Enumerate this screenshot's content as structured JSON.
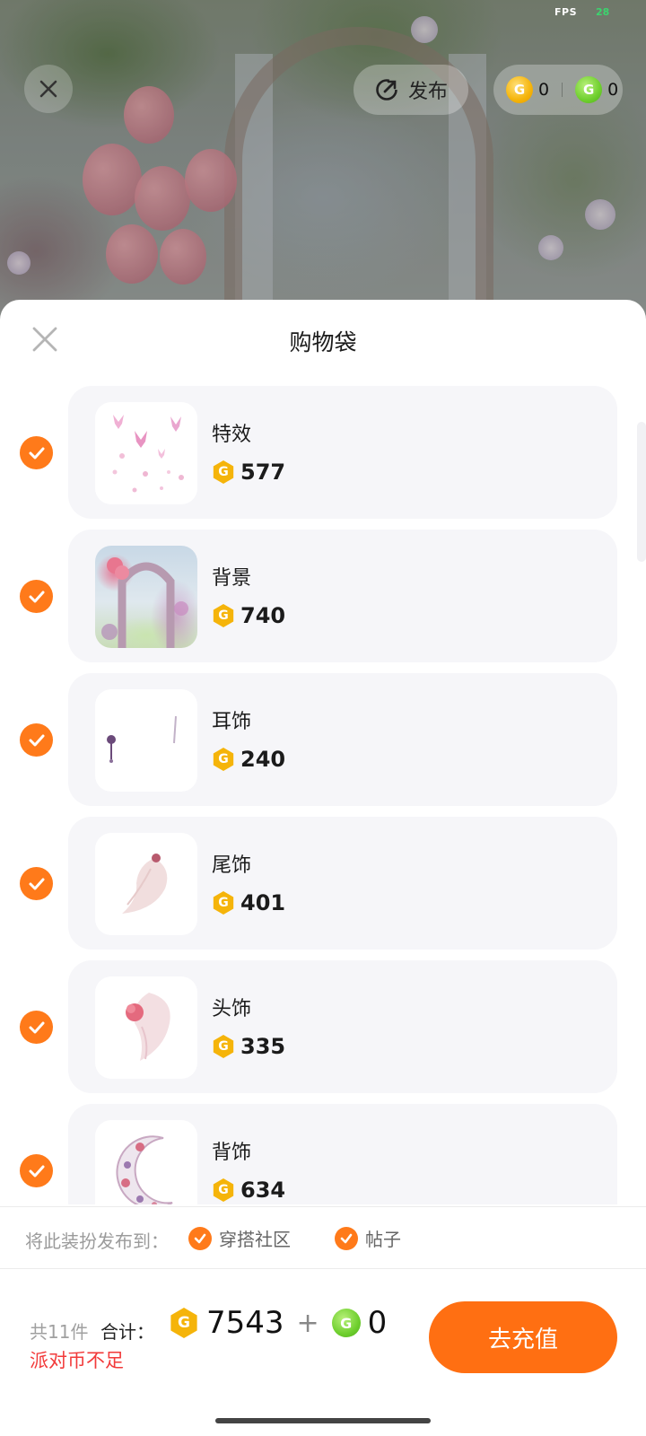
{
  "status": {
    "fps_label": "FPS",
    "fps_value": "28"
  },
  "topbar": {
    "publish_label": "发布",
    "gold_balance": "0",
    "green_balance": "0"
  },
  "sheet": {
    "title": "购物袋"
  },
  "items": [
    {
      "name": "特效",
      "price": "577",
      "checked": true
    },
    {
      "name": "背景",
      "price": "740",
      "checked": true
    },
    {
      "name": "耳饰",
      "price": "240",
      "checked": true
    },
    {
      "name": "尾饰",
      "price": "401",
      "checked": true
    },
    {
      "name": "头饰",
      "price": "335",
      "checked": true
    },
    {
      "name": "背饰",
      "price": "634",
      "checked": true
    }
  ],
  "publish_to": {
    "label": "将此装扮发布到：",
    "options": [
      {
        "label": "穿搭社区",
        "checked": true
      },
      {
        "label": "帖子",
        "checked": true
      }
    ]
  },
  "summary": {
    "count_text": "共11件",
    "total_label": "合计：",
    "gold_total": "7543",
    "plus": "+",
    "green_total": "0",
    "warning": "派对币不足",
    "recharge_label": "去充值"
  },
  "colors": {
    "accent": "#ff6f12",
    "check": "#ff7a1a",
    "warning": "#f23a3a",
    "gold_coin": "#f5b40a",
    "green_coin": "#6fcf2e"
  },
  "icons": {
    "close": "close-icon",
    "publish": "publish-icon",
    "gold_coin": "gold-coin-icon",
    "green_coin": "green-coin-icon",
    "check": "check-icon"
  }
}
